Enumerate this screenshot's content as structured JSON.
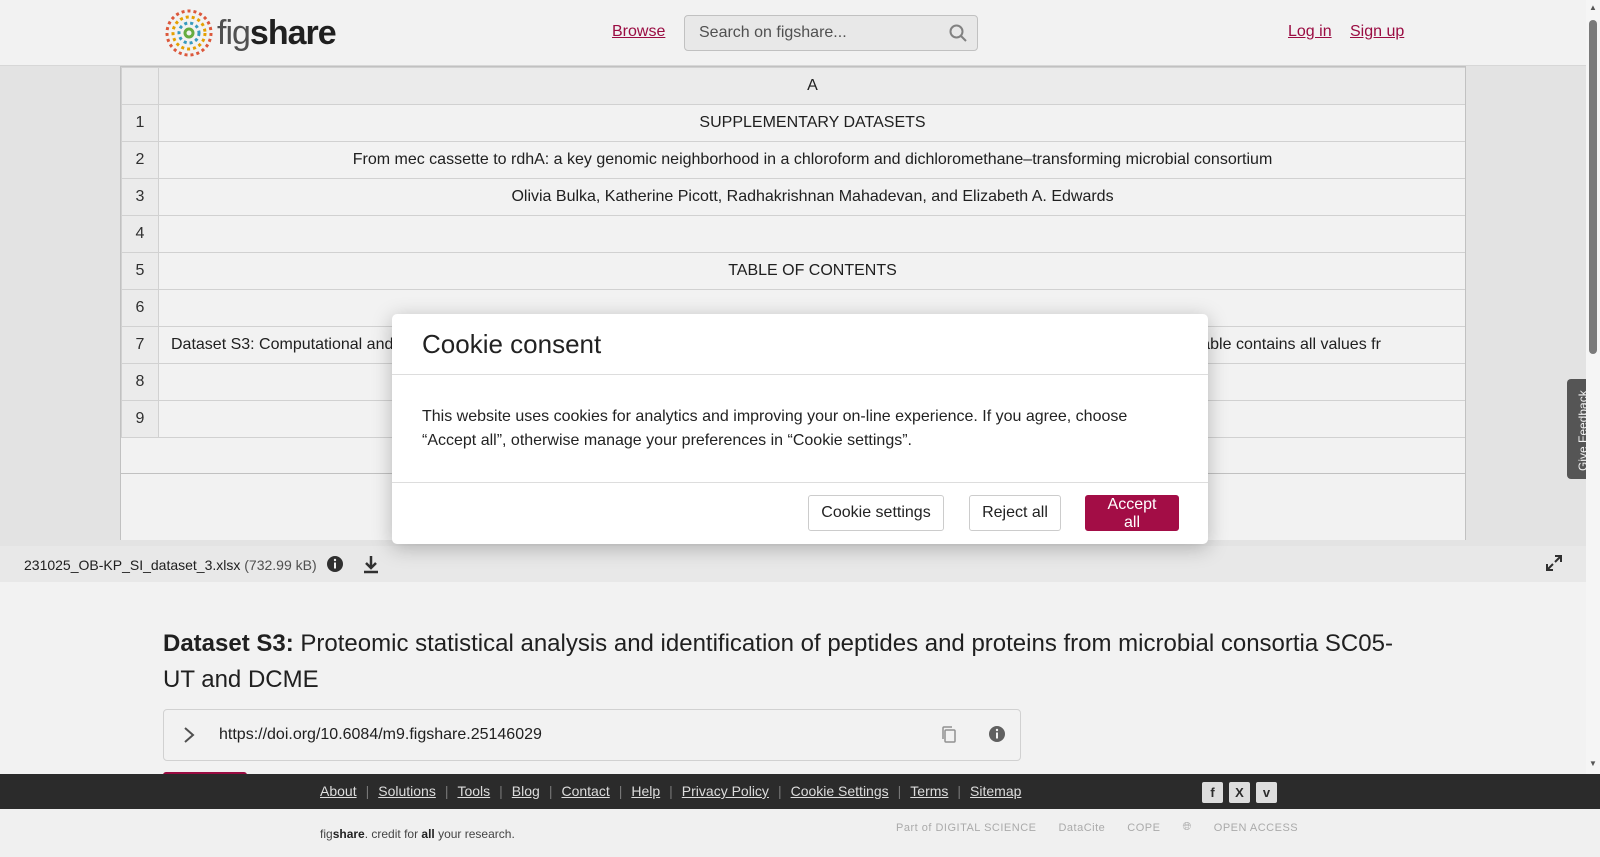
{
  "header": {
    "logo_prefix": "fig",
    "logo_suffix": "share",
    "browse": "Browse",
    "search_placeholder": "Search on figshare...",
    "login": "Log in",
    "signup": "Sign up"
  },
  "sheet": {
    "column_header": "A",
    "rows": [
      {
        "num": "1",
        "text": "SUPPLEMENTARY DATASETS"
      },
      {
        "num": "2",
        "text": "From mec cassette to rdhA: a key genomic neighborhood in a chloroform and dichloromethane–transforming microbial consortium"
      },
      {
        "num": "3",
        "text": "Olivia Bulka, Katherine Picott, Radhakrishnan Mahadevan, and Elizabeth A. Edwards"
      },
      {
        "num": "4",
        "text": ""
      },
      {
        "num": "5",
        "text": "TABLE OF CONTENTS"
      },
      {
        "num": "6",
        "text": ""
      },
      {
        "num": "7",
        "text": "Dataset S3: Computational and                                                                                                                                                                   utput. This table contains all values fr"
      },
      {
        "num": "8",
        "text": ""
      },
      {
        "num": "9",
        "text": ""
      }
    ]
  },
  "file": {
    "name": "231025_OB-KP_SI_dataset_3.xlsx",
    "size": "(732.99 kB)"
  },
  "item": {
    "title_bold": "Dataset S3:",
    "title_rest": " Proteomic statistical analysis and identification of peptides and proteins from microbial consortia SC05-UT and DCME",
    "doi": "https://doi.org/10.6084/m9.figshare.25146029"
  },
  "cookie": {
    "title": "Cookie consent",
    "body": "This website uses cookies for analytics and improving your on-line experience. If you agree, choose “Accept all”, otherwise manage your preferences in “Cookie settings”.",
    "settings": "Cookie settings",
    "reject": "Reject all",
    "accept": "Accept all"
  },
  "feedback": "Give Feedback",
  "footer": {
    "links": [
      "About",
      "Solutions",
      "Tools",
      "Blog",
      "Contact",
      "Help",
      "Privacy Policy",
      "Cookie Settings",
      "Terms",
      "Sitemap"
    ],
    "tagline_pre": "fig",
    "tagline_brand": "share",
    "tagline_mid": ". credit for ",
    "tagline_all": "all",
    "tagline_end": " your research.",
    "partners": [
      "Part of DIGITAL SCIENCE",
      "DataCite",
      "COPE",
      "",
      "OPEN ACCESS"
    ]
  },
  "colors": {
    "brand": "#a30d46",
    "footer_dark": "#2b2b2b"
  }
}
